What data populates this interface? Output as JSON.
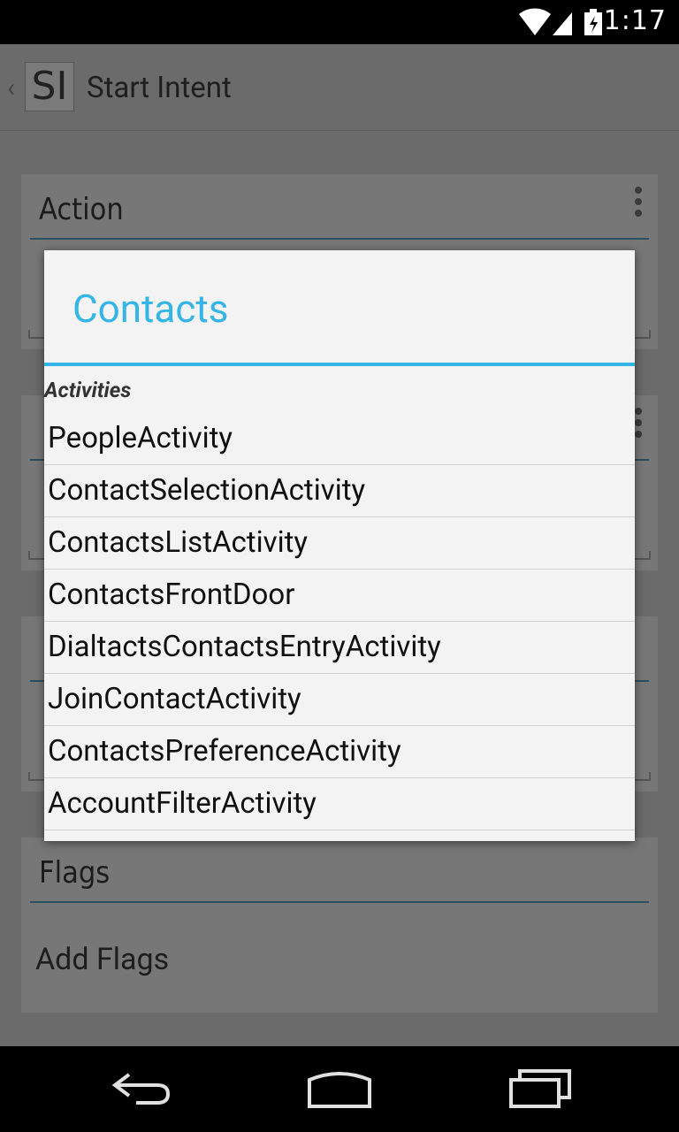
{
  "status_bar": {
    "time": "1:17"
  },
  "action_bar": {
    "logo": "SI",
    "title": "Start Intent"
  },
  "sections": {
    "action": {
      "title": "Action"
    },
    "flags": {
      "title": "Flags",
      "add_flags": "Add Flags"
    }
  },
  "dialog": {
    "title": "Contacts",
    "header": "Activities",
    "items": [
      "PeopleActivity",
      "ContactSelectionActivity",
      "ContactsListActivity",
      "ContactsFrontDoor",
      "DialtactsContactsEntryActivity",
      "JoinContactActivity",
      "ContactsPreferenceActivity",
      "AccountFilterActivity"
    ]
  },
  "colors": {
    "accent": "#33b5e5",
    "dim_background": "#6b6b6b"
  }
}
